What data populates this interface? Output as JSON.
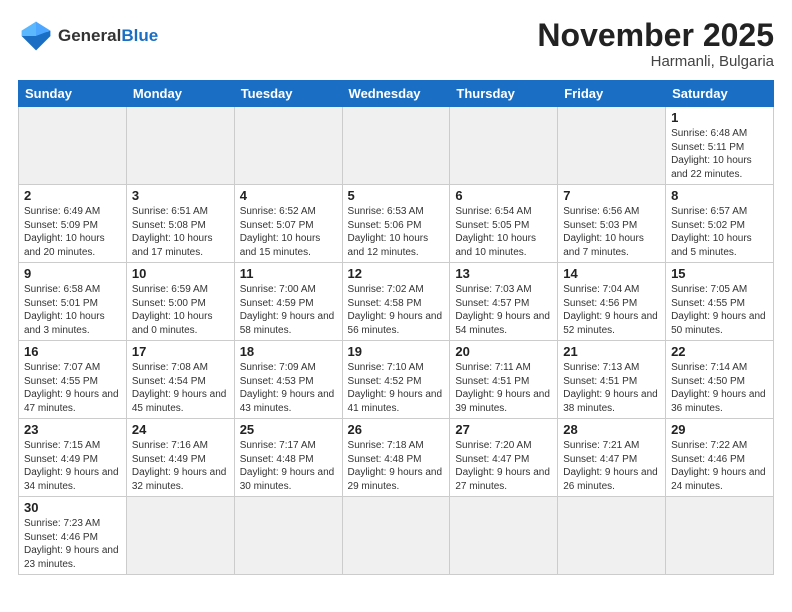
{
  "logo": {
    "general": "General",
    "blue": "Blue"
  },
  "header": {
    "month": "November 2025",
    "location": "Harmanli, Bulgaria"
  },
  "weekdays": [
    "Sunday",
    "Monday",
    "Tuesday",
    "Wednesday",
    "Thursday",
    "Friday",
    "Saturday"
  ],
  "weeks": [
    [
      {
        "day": "",
        "info": ""
      },
      {
        "day": "",
        "info": ""
      },
      {
        "day": "",
        "info": ""
      },
      {
        "day": "",
        "info": ""
      },
      {
        "day": "",
        "info": ""
      },
      {
        "day": "",
        "info": ""
      },
      {
        "day": "1",
        "info": "Sunrise: 6:48 AM\nSunset: 5:11 PM\nDaylight: 10 hours\nand 22 minutes."
      }
    ],
    [
      {
        "day": "2",
        "info": "Sunrise: 6:49 AM\nSunset: 5:09 PM\nDaylight: 10 hours\nand 20 minutes."
      },
      {
        "day": "3",
        "info": "Sunrise: 6:51 AM\nSunset: 5:08 PM\nDaylight: 10 hours\nand 17 minutes."
      },
      {
        "day": "4",
        "info": "Sunrise: 6:52 AM\nSunset: 5:07 PM\nDaylight: 10 hours\nand 15 minutes."
      },
      {
        "day": "5",
        "info": "Sunrise: 6:53 AM\nSunset: 5:06 PM\nDaylight: 10 hours\nand 12 minutes."
      },
      {
        "day": "6",
        "info": "Sunrise: 6:54 AM\nSunset: 5:05 PM\nDaylight: 10 hours\nand 10 minutes."
      },
      {
        "day": "7",
        "info": "Sunrise: 6:56 AM\nSunset: 5:03 PM\nDaylight: 10 hours\nand 7 minutes."
      },
      {
        "day": "8",
        "info": "Sunrise: 6:57 AM\nSunset: 5:02 PM\nDaylight: 10 hours\nand 5 minutes."
      }
    ],
    [
      {
        "day": "9",
        "info": "Sunrise: 6:58 AM\nSunset: 5:01 PM\nDaylight: 10 hours\nand 3 minutes."
      },
      {
        "day": "10",
        "info": "Sunrise: 6:59 AM\nSunset: 5:00 PM\nDaylight: 10 hours\nand 0 minutes."
      },
      {
        "day": "11",
        "info": "Sunrise: 7:00 AM\nSunset: 4:59 PM\nDaylight: 9 hours\nand 58 minutes."
      },
      {
        "day": "12",
        "info": "Sunrise: 7:02 AM\nSunset: 4:58 PM\nDaylight: 9 hours\nand 56 minutes."
      },
      {
        "day": "13",
        "info": "Sunrise: 7:03 AM\nSunset: 4:57 PM\nDaylight: 9 hours\nand 54 minutes."
      },
      {
        "day": "14",
        "info": "Sunrise: 7:04 AM\nSunset: 4:56 PM\nDaylight: 9 hours\nand 52 minutes."
      },
      {
        "day": "15",
        "info": "Sunrise: 7:05 AM\nSunset: 4:55 PM\nDaylight: 9 hours\nand 50 minutes."
      }
    ],
    [
      {
        "day": "16",
        "info": "Sunrise: 7:07 AM\nSunset: 4:55 PM\nDaylight: 9 hours\nand 47 minutes."
      },
      {
        "day": "17",
        "info": "Sunrise: 7:08 AM\nSunset: 4:54 PM\nDaylight: 9 hours\nand 45 minutes."
      },
      {
        "day": "18",
        "info": "Sunrise: 7:09 AM\nSunset: 4:53 PM\nDaylight: 9 hours\nand 43 minutes."
      },
      {
        "day": "19",
        "info": "Sunrise: 7:10 AM\nSunset: 4:52 PM\nDaylight: 9 hours\nand 41 minutes."
      },
      {
        "day": "20",
        "info": "Sunrise: 7:11 AM\nSunset: 4:51 PM\nDaylight: 9 hours\nand 39 minutes."
      },
      {
        "day": "21",
        "info": "Sunrise: 7:13 AM\nSunset: 4:51 PM\nDaylight: 9 hours\nand 38 minutes."
      },
      {
        "day": "22",
        "info": "Sunrise: 7:14 AM\nSunset: 4:50 PM\nDaylight: 9 hours\nand 36 minutes."
      }
    ],
    [
      {
        "day": "23",
        "info": "Sunrise: 7:15 AM\nSunset: 4:49 PM\nDaylight: 9 hours\nand 34 minutes."
      },
      {
        "day": "24",
        "info": "Sunrise: 7:16 AM\nSunset: 4:49 PM\nDaylight: 9 hours\nand 32 minutes."
      },
      {
        "day": "25",
        "info": "Sunrise: 7:17 AM\nSunset: 4:48 PM\nDaylight: 9 hours\nand 30 minutes."
      },
      {
        "day": "26",
        "info": "Sunrise: 7:18 AM\nSunset: 4:48 PM\nDaylight: 9 hours\nand 29 minutes."
      },
      {
        "day": "27",
        "info": "Sunrise: 7:20 AM\nSunset: 4:47 PM\nDaylight: 9 hours\nand 27 minutes."
      },
      {
        "day": "28",
        "info": "Sunrise: 7:21 AM\nSunset: 4:47 PM\nDaylight: 9 hours\nand 26 minutes."
      },
      {
        "day": "29",
        "info": "Sunrise: 7:22 AM\nSunset: 4:46 PM\nDaylight: 9 hours\nand 24 minutes."
      }
    ],
    [
      {
        "day": "30",
        "info": "Sunrise: 7:23 AM\nSunset: 4:46 PM\nDaylight: 9 hours\nand 23 minutes."
      },
      {
        "day": "",
        "info": ""
      },
      {
        "day": "",
        "info": ""
      },
      {
        "day": "",
        "info": ""
      },
      {
        "day": "",
        "info": ""
      },
      {
        "day": "",
        "info": ""
      },
      {
        "day": "",
        "info": ""
      }
    ]
  ]
}
